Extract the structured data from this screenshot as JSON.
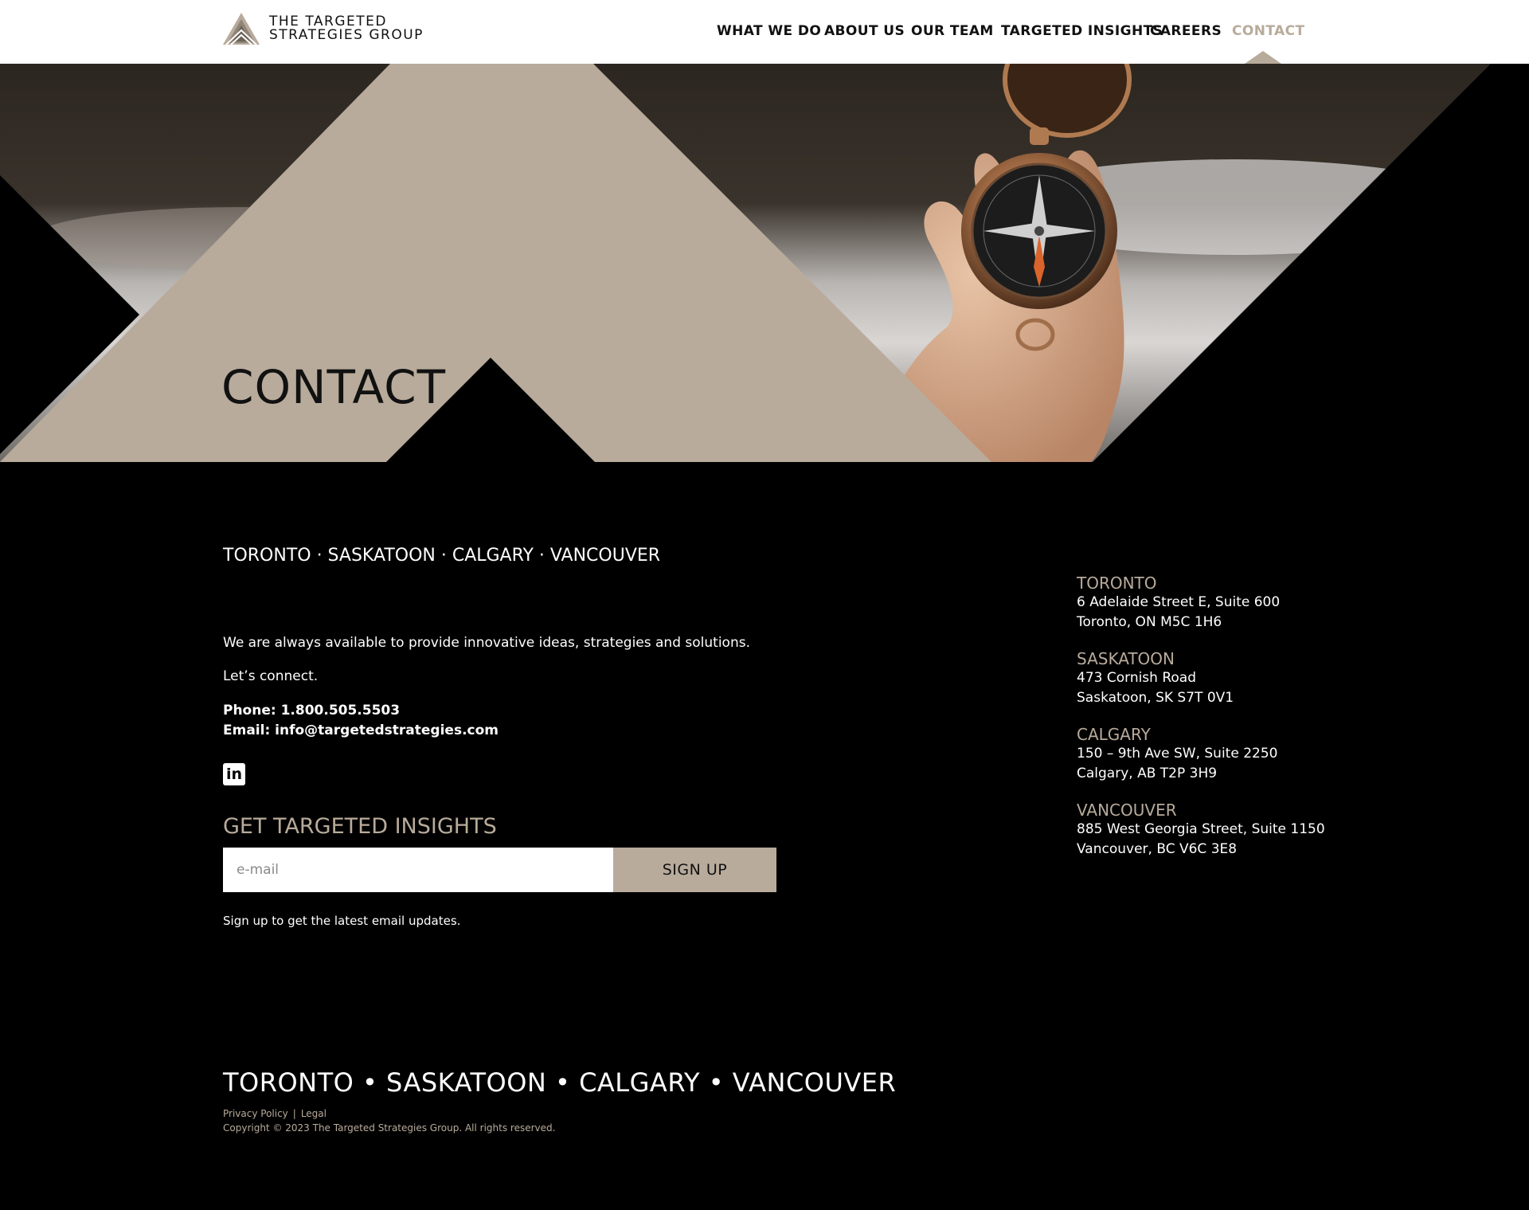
{
  "brand": {
    "logo_line1": "THE TARGETED",
    "logo_line2": "STRATEGIES GROUP",
    "accent_color": "#b8ab9b",
    "background_color": "#000000"
  },
  "nav": {
    "items": [
      {
        "label": "WHAT WE DO"
      },
      {
        "label": "ABOUT US"
      },
      {
        "label": "OUR TEAM"
      },
      {
        "label": "TARGETED INSIGHTS"
      },
      {
        "label": "CAREERS"
      },
      {
        "label": "CONTACT",
        "active": true
      }
    ]
  },
  "hero": {
    "title": "CONTACT",
    "image": "hand-holding-compass"
  },
  "main": {
    "cities_inline": "TORONTO · SASKATOON · CALGARY · VANCOUVER",
    "intro": "We are always available to provide innovative ideas, strategies and solutions.",
    "connect": "Let’s connect.",
    "phone": "Phone: 1.800.505.5503",
    "email": "Email: info@targetedstrategies.com",
    "social_icon": "linkedin-icon",
    "social_label": "in"
  },
  "newsletter": {
    "title": "GET TARGETED INSIGHTS",
    "placeholder": "e-mail",
    "button_label": "SIGN UP",
    "note": "Sign up to get the latest email updates."
  },
  "offices": [
    {
      "city": "TORONTO",
      "line1": "6 Adelaide Street E, Suite 600",
      "line2": "Toronto, ON M5C 1H6"
    },
    {
      "city": "SASKATOON",
      "line1": "473 Cornish Road",
      "line2": "Saskatoon, SK S7T 0V1"
    },
    {
      "city": "CALGARY",
      "line1": "150 – 9th Ave SW, Suite 2250",
      "line2": "Calgary, AB T2P 3H9"
    },
    {
      "city": "VANCOUVER",
      "line1": "885 West Georgia Street, Suite 1150",
      "line2": "Vancouver, BC V6C 3E8"
    }
  ],
  "footer": {
    "cities": "TORONTO • SASKATOON • CALGARY • VANCOUVER",
    "privacy_label": "Privacy Policy",
    "separator": "|",
    "legal_label": "Legal",
    "copyright": "Copyright © 2023 The Targeted Strategies Group. All rights reserved."
  }
}
